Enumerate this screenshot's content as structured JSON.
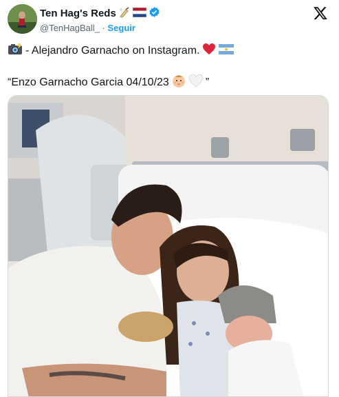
{
  "tweet": {
    "author": {
      "display_name": "Ten Hag's Reds",
      "handle": "@TenHagBall_",
      "separator": "·",
      "follow_label": "Seguir",
      "name_emojis": [
        "cricket-bat-icon",
        "netherlands-flag-icon"
      ],
      "verified": true
    },
    "line1": {
      "emoji": "camera-flash-icon",
      "text": "- Alejandro Garnacho on Instagram.",
      "trailing_emojis": [
        "red-heart-icon",
        "argentina-flag-icon"
      ]
    },
    "line2": {
      "text_open": "“Enzo Garnacho Garcia 04/10/23",
      "trailing_emojis": [
        "baby-face-icon",
        "white-heart-icon"
      ],
      "text_close": "”"
    },
    "media": {
      "type": "photo",
      "subject": "couple with newborn baby in hospital bed"
    }
  },
  "colors": {
    "text": "#0f1419",
    "secondary": "#536471",
    "accent": "#1d9bf0",
    "border": "#cfd9de"
  }
}
